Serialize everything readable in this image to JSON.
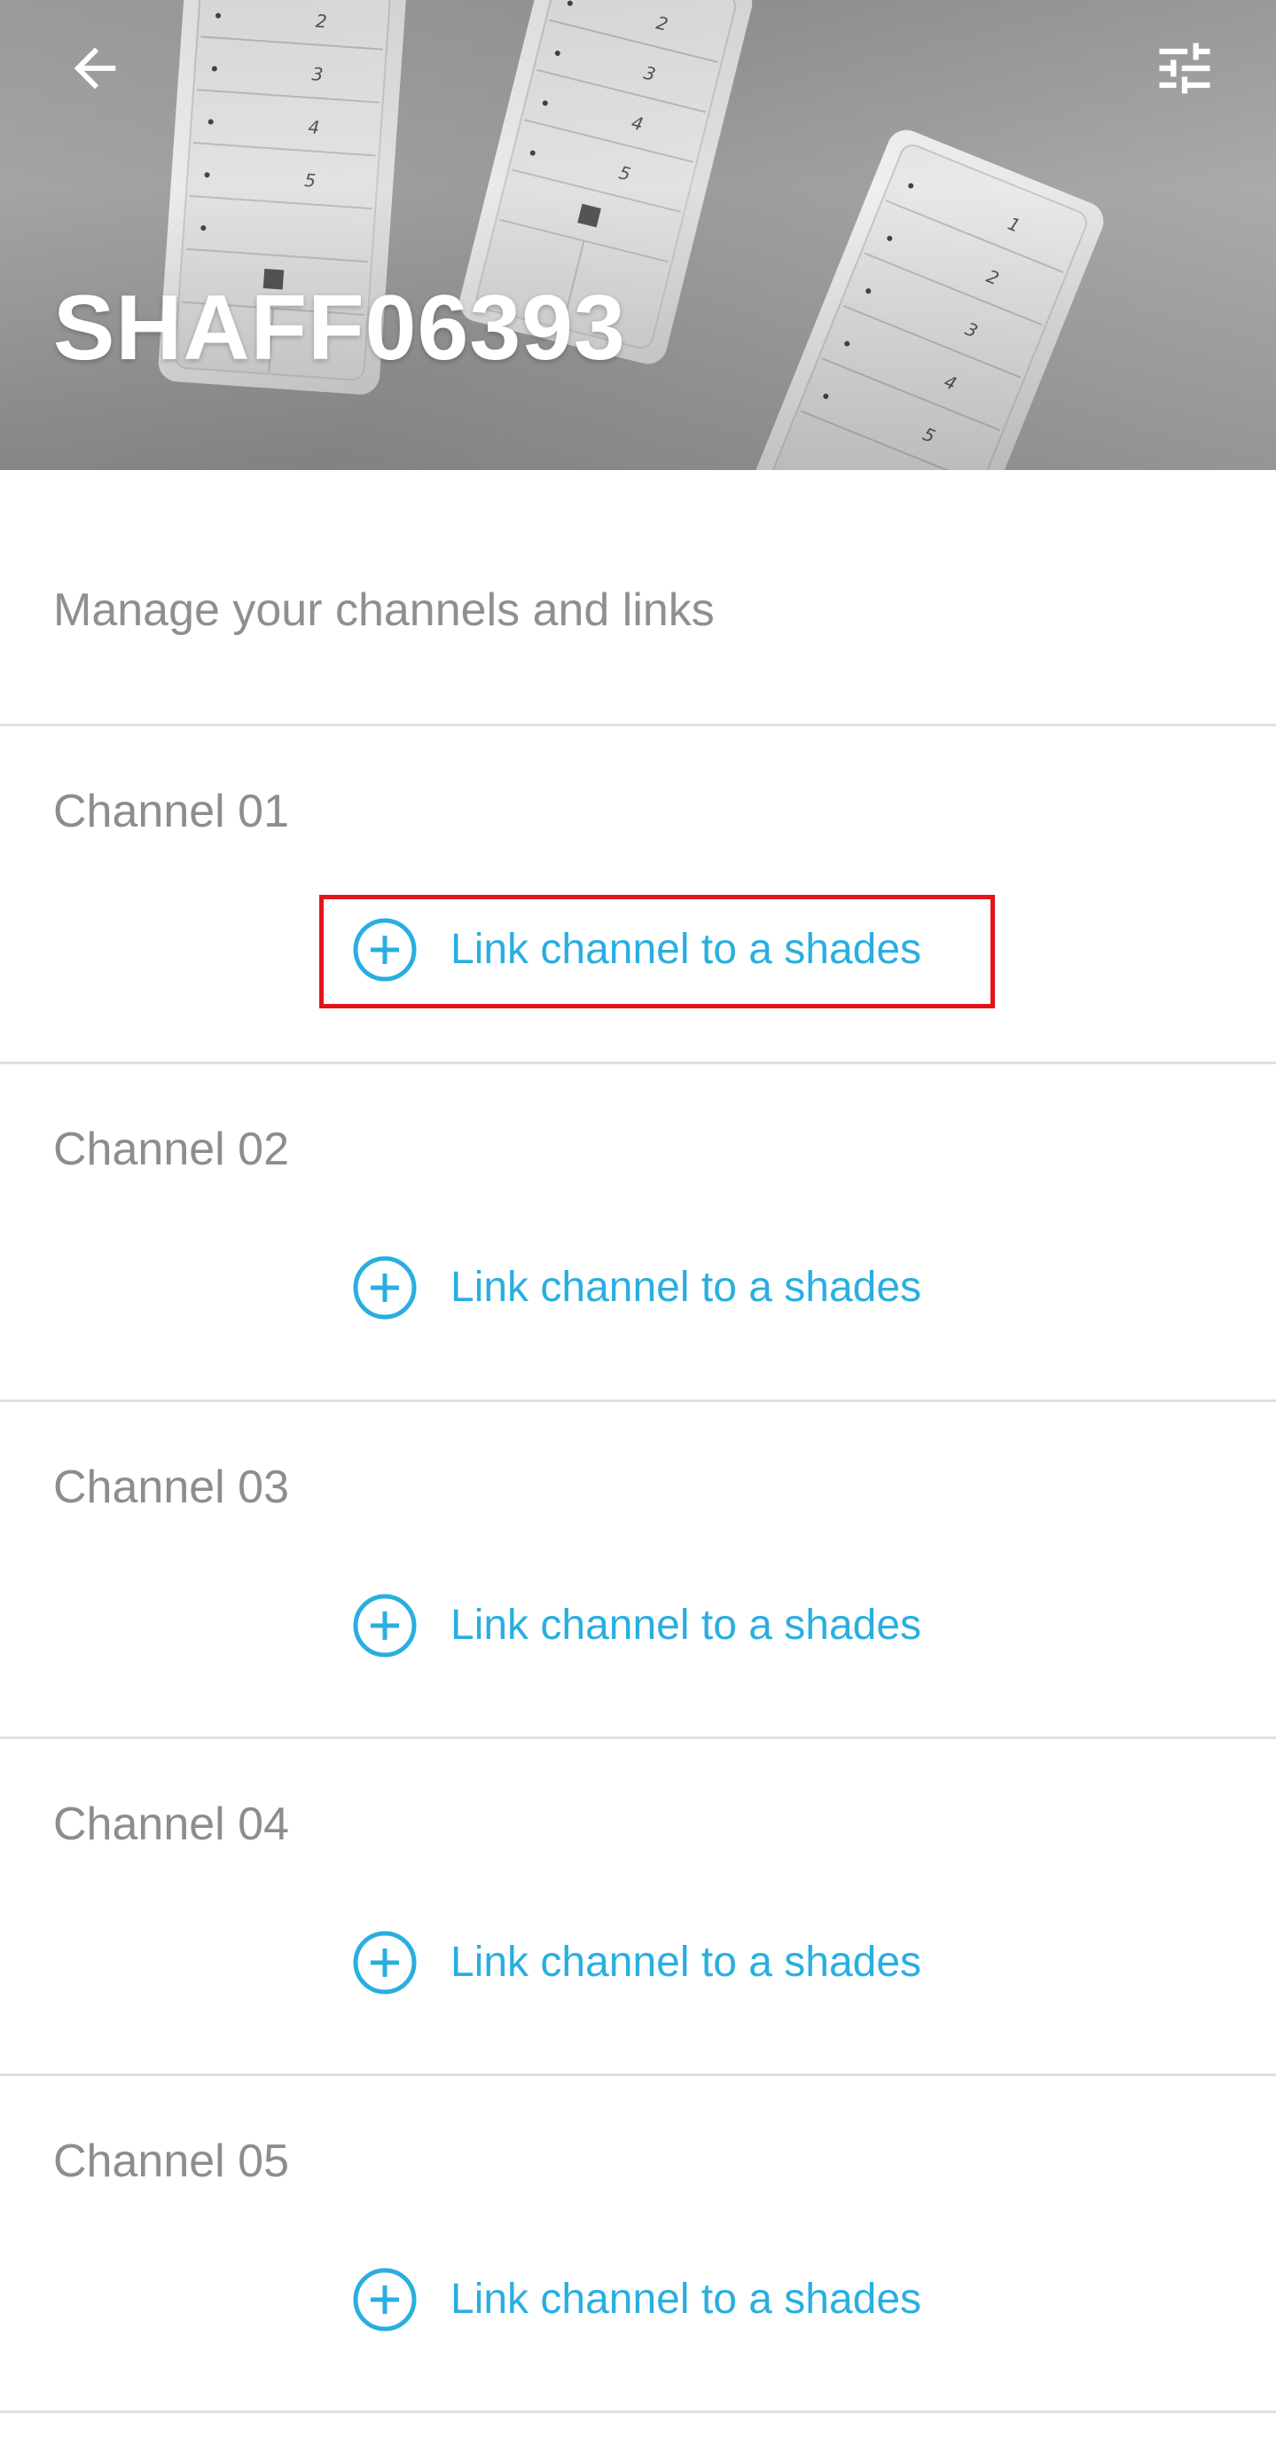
{
  "header": {
    "title": "SHAFF06393",
    "back_icon": "arrow-left-icon",
    "filter_icon": "sliders-icon",
    "remote_button_numbers": [
      "1",
      "2",
      "3",
      "4",
      "5"
    ]
  },
  "intro_text": "Manage your channels and links",
  "channels": [
    {
      "name": "Channel 01",
      "link_label": "Link channel to a shades",
      "highlighted": true
    },
    {
      "name": "Channel 02",
      "link_label": "Link channel to a shades",
      "highlighted": false
    },
    {
      "name": "Channel 03",
      "link_label": "Link channel to a shades",
      "highlighted": false
    },
    {
      "name": "Channel 04",
      "link_label": "Link channel to a shades",
      "highlighted": false
    },
    {
      "name": "Channel 05",
      "link_label": "Link channel to a shades",
      "highlighted": false
    }
  ],
  "colors": {
    "accent": "#2aaee0",
    "highlight": "#e2141c",
    "text_muted": "#8d8d8d",
    "divider": "#dfdfdf"
  }
}
